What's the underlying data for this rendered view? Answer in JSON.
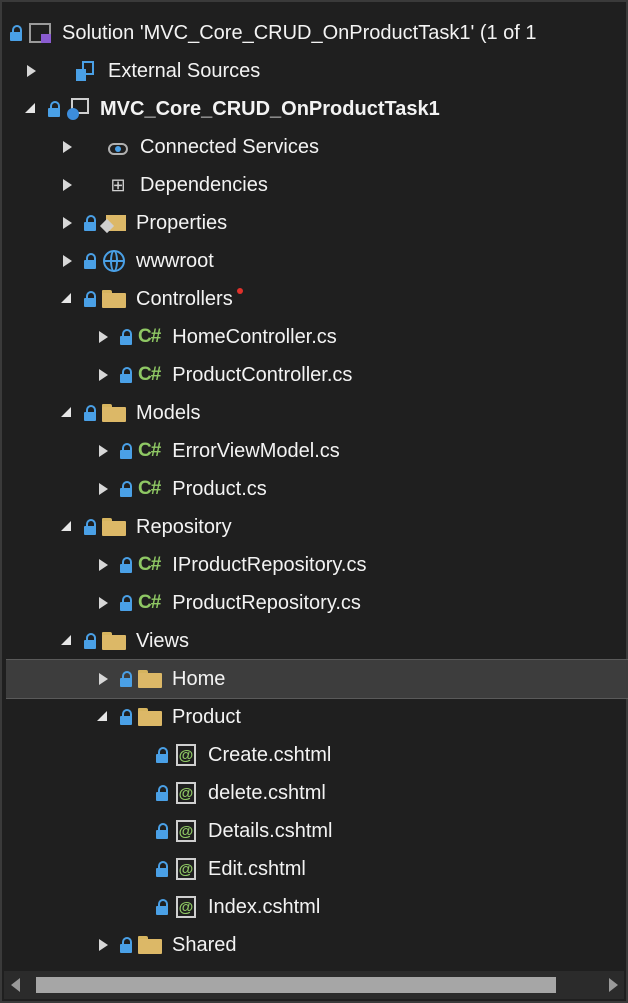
{
  "explorer": {
    "rows": [
      {
        "label": "Solution 'MVC_Core_CRUD_OnProductTask1' (1 of 1",
        "icon": "solution-icon"
      },
      {
        "label": "External Sources",
        "icon": "external-sources-icon"
      },
      {
        "label": "MVC_Core_CRUD_OnProductTask1",
        "icon": "csharp-project-icon"
      },
      {
        "label": "Connected Services",
        "icon": "connected-services-icon"
      },
      {
        "label": "Dependencies",
        "icon": "dependencies-icon"
      },
      {
        "label": "Properties",
        "icon": "properties-icon"
      },
      {
        "label": "wwwroot",
        "icon": "globe-icon"
      },
      {
        "label": "Controllers",
        "icon": "folder-icon"
      },
      {
        "label": "HomeController.cs",
        "icon": "csharp-file-icon"
      },
      {
        "label": "ProductController.cs",
        "icon": "csharp-file-icon"
      },
      {
        "label": "Models",
        "icon": "folder-icon"
      },
      {
        "label": "ErrorViewModel.cs",
        "icon": "csharp-file-icon"
      },
      {
        "label": "Product.cs",
        "icon": "csharp-file-icon"
      },
      {
        "label": "Repository",
        "icon": "folder-icon"
      },
      {
        "label": "IProductRepository.cs",
        "icon": "csharp-file-icon"
      },
      {
        "label": "ProductRepository.cs",
        "icon": "csharp-file-icon"
      },
      {
        "label": "Views",
        "icon": "folder-icon"
      },
      {
        "label": "Home",
        "icon": "folder-icon"
      },
      {
        "label": "Product",
        "icon": "folder-icon"
      },
      {
        "label": "Create.cshtml",
        "icon": "razor-file-icon"
      },
      {
        "label": "delete.cshtml",
        "icon": "razor-file-icon"
      },
      {
        "label": "Details.cshtml",
        "icon": "razor-file-icon"
      },
      {
        "label": "Edit.cshtml",
        "icon": "razor-file-icon"
      },
      {
        "label": "Index.cshtml",
        "icon": "razor-file-icon"
      },
      {
        "label": "Shared",
        "icon": "folder-icon"
      }
    ],
    "csharp_glyph": "C#",
    "razor_glyph": "@",
    "dependencies_glyph": "⊞"
  },
  "colors": {
    "background": "#1f1f1f",
    "selected_row": "#3d3d3d",
    "lock_blue": "#4aa0e6",
    "folder_yellow": "#dcb867",
    "csharp_green": "#8fc864"
  }
}
